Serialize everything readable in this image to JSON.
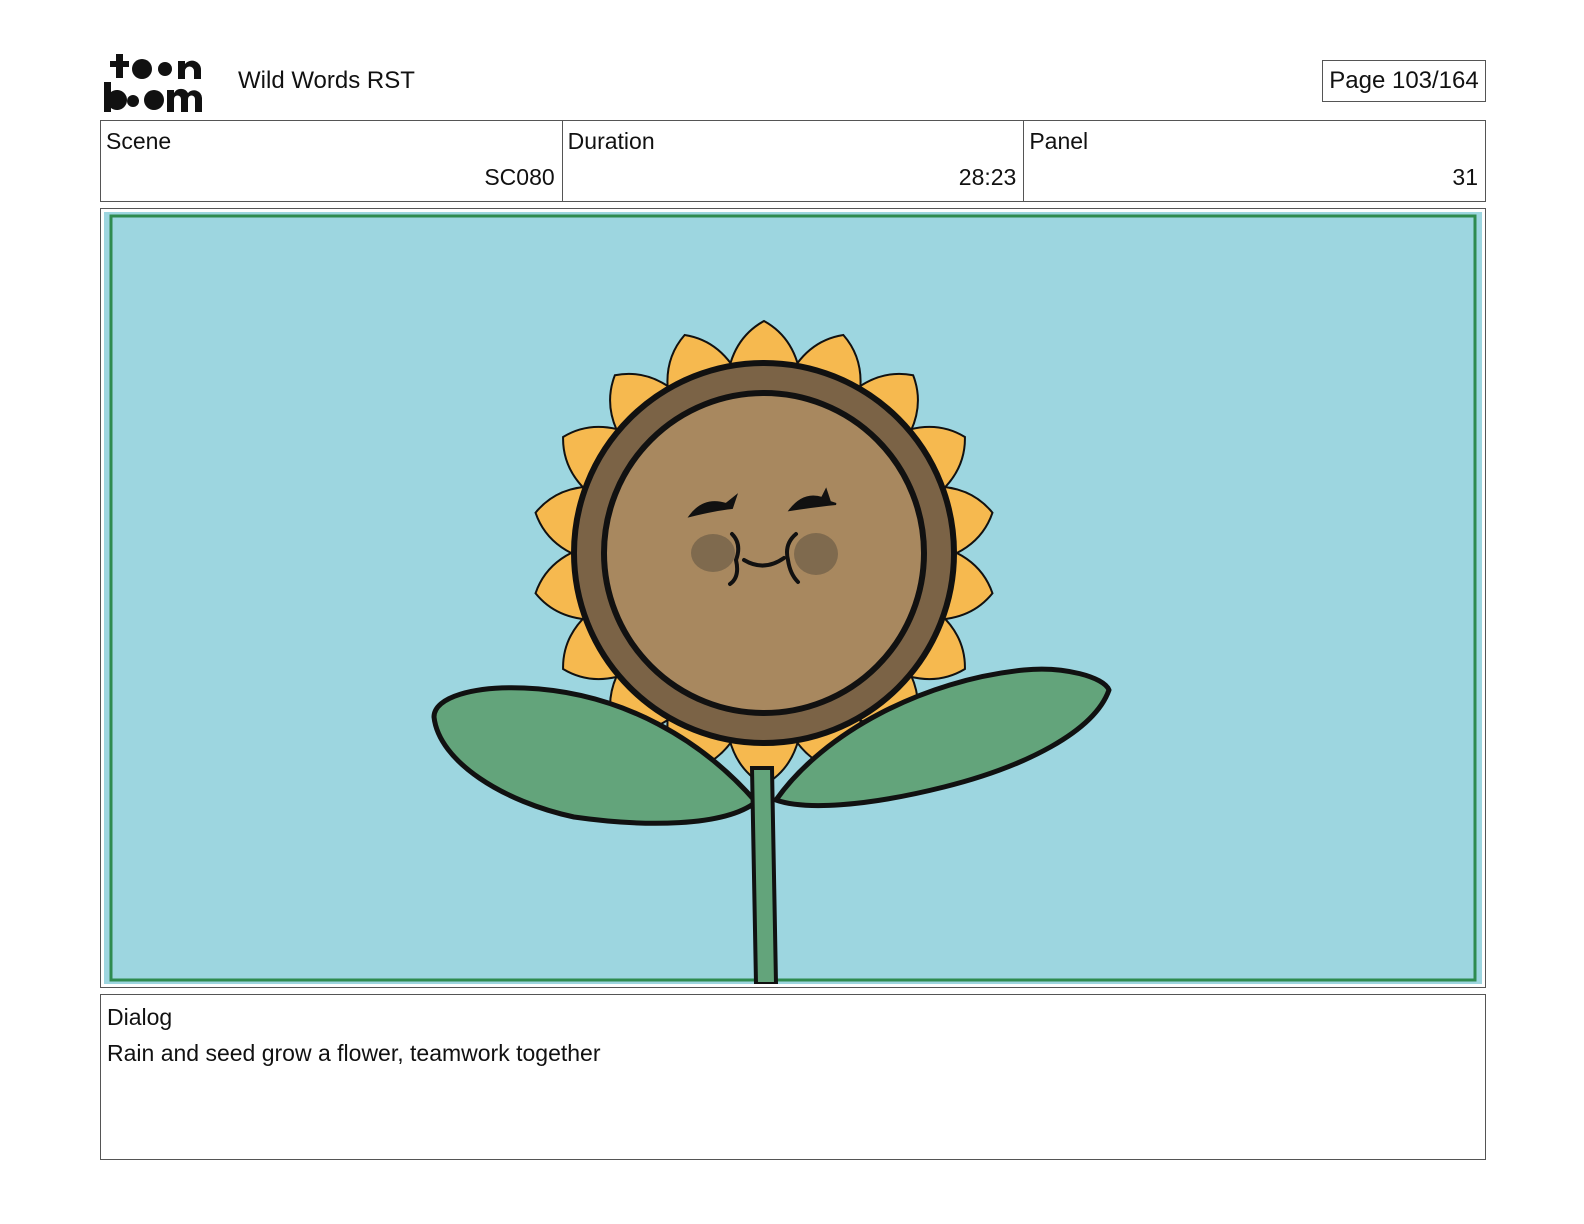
{
  "header": {
    "logo": {
      "icon": "toonboom-logo-icon",
      "text": "toonboom"
    },
    "project_title": "Wild Words RST",
    "page_indicator": "Page 103/164"
  },
  "info": {
    "scene": {
      "label": "Scene",
      "value": "SC080"
    },
    "duration": {
      "label": "Duration",
      "value": "28:23"
    },
    "panel": {
      "label": "Panel",
      "value": "31"
    }
  },
  "panel_image": {
    "icon": "smiling-sunflower-drawing",
    "colors": {
      "sky": "#9dd6e0",
      "frame_green": "#2e8b4f",
      "petal": "#f6b94f",
      "disk_outer": "#7b6346",
      "disk_inner": "#a8885f",
      "cheek": "#7f6a4e",
      "leaf": "#63a47b",
      "outline": "#111111"
    }
  },
  "dialog": {
    "label": "Dialog",
    "text": "Rain and seed grow a flower, teamwork together"
  }
}
